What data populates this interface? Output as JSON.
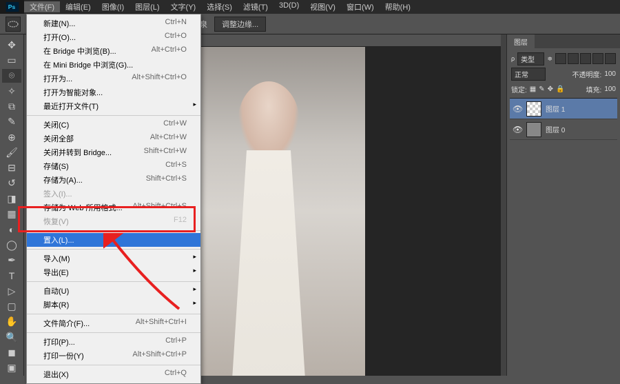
{
  "menubar": [
    {
      "label": "文件(F)",
      "active": true
    },
    {
      "label": "编辑(E)"
    },
    {
      "label": "图像(I)"
    },
    {
      "label": "图层(L)"
    },
    {
      "label": "文字(Y)"
    },
    {
      "label": "选择(S)"
    },
    {
      "label": "滤镜(T)"
    },
    {
      "label": "3D(D)"
    },
    {
      "label": "视图(V)"
    },
    {
      "label": "窗口(W)"
    },
    {
      "label": "帮助(H)"
    }
  ],
  "optionsbar": {
    "hidden_label": "泉",
    "refine_edge": "调整边缘..."
  },
  "file_menu": {
    "new": "新建(N)...",
    "new_sc": "Ctrl+N",
    "open": "打开(O)...",
    "open_sc": "Ctrl+O",
    "browse_bridge": "在 Bridge 中浏览(B)...",
    "browse_bridge_sc": "Alt+Ctrl+O",
    "browse_mini": "在 Mini Bridge 中浏览(G)...",
    "open_as": "打开为...",
    "open_as_sc": "Alt+Shift+Ctrl+O",
    "open_smart": "打开为智能对象...",
    "open_recent": "最近打开文件(T)",
    "close": "关闭(C)",
    "close_sc": "Ctrl+W",
    "close_all": "关闭全部",
    "close_all_sc": "Alt+Ctrl+W",
    "close_bridge": "关闭并转到 Bridge...",
    "close_bridge_sc": "Shift+Ctrl+W",
    "save": "存储(S)",
    "save_sc": "Ctrl+S",
    "save_as": "存储为(A)...",
    "save_as_sc": "Shift+Ctrl+S",
    "checkin": "签入(I)...",
    "save_web": "存储为 Web 所用格式...",
    "save_web_sc": "Alt+Shift+Ctrl+S",
    "revert_disabled": "恢复(V)",
    "revert_sc": "F12",
    "place": "置入(L)...",
    "import": "导入(M)",
    "export": "导出(E)",
    "automate": "自动(U)",
    "scripts": "脚本(R)",
    "file_info": "文件简介(F)...",
    "file_info_sc": "Alt+Shift+Ctrl+I",
    "print": "打印(P)...",
    "print_sc": "Ctrl+P",
    "print_one": "打印一份(Y)",
    "print_one_sc": "Alt+Shift+Ctrl+P",
    "exit": "退出(X)",
    "exit_sc": "Ctrl+Q"
  },
  "layers_panel": {
    "title": "图层",
    "kind": "类型",
    "blend": "正常",
    "opacity_label": "不透明度:",
    "opacity": "100",
    "lock_label": "锁定:",
    "fill_label": "填充:",
    "fill": "100",
    "layers": [
      {
        "name": "图层 1",
        "selected": true
      },
      {
        "name": "图层 0",
        "selected": false
      }
    ]
  }
}
